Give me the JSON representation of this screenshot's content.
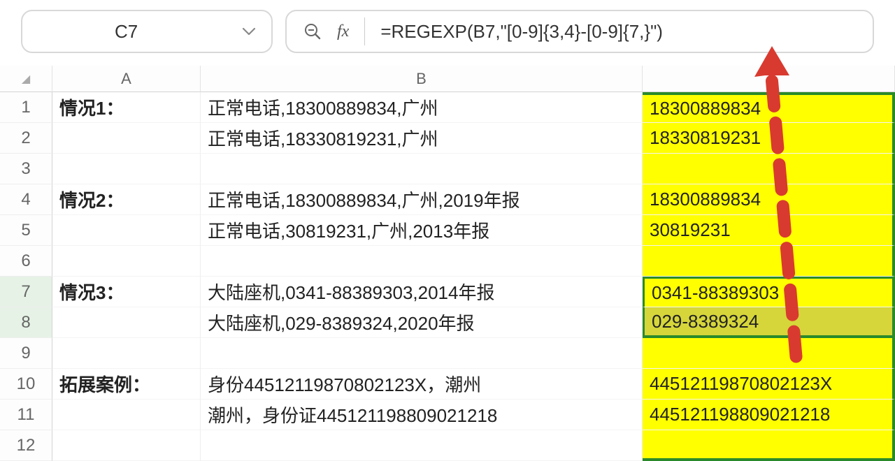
{
  "namebox": {
    "cell_ref": "C7"
  },
  "formula_bar": {
    "fx_label": "fx",
    "formula": "=REGEXP(B7,\"[0-9]{3,4}-[0-9]{7,}\")"
  },
  "columns": [
    "A",
    "B"
  ],
  "rows": [
    {
      "n": "1",
      "A": "情况1：",
      "B": "正常电话,18300889834,广州",
      "C": "18300889834"
    },
    {
      "n": "2",
      "A": "",
      "B": "正常电话,18330819231,广州",
      "C": "18330819231"
    },
    {
      "n": "3",
      "A": "",
      "B": "",
      "C": ""
    },
    {
      "n": "4",
      "A": "情况2：",
      "B": "正常电话,18300889834,广州,2019年报",
      "C": "18300889834"
    },
    {
      "n": "5",
      "A": "",
      "B": "正常电话,30819231,广州,2013年报",
      "C": "30819231"
    },
    {
      "n": "6",
      "A": "",
      "B": "",
      "C": ""
    },
    {
      "n": "7",
      "A": "情况3：",
      "B": "大陆座机,0341-88389303,2014年报",
      "C": "0341-88389303"
    },
    {
      "n": "8",
      "A": "",
      "B": "大陆座机,029-8389324,2020年报",
      "C": "029-8389324"
    },
    {
      "n": "9",
      "A": "",
      "B": "",
      "C": ""
    },
    {
      "n": "10",
      "A": "拓展案例：",
      "B": "身份44512119870802123X，潮州",
      "C": "44512119870802123X"
    },
    {
      "n": "11",
      "A": "",
      "B": "潮州，身份证445121198809021218",
      "C": "445121198809021218"
    },
    {
      "n": "12",
      "A": "",
      "B": "",
      "C": ""
    }
  ]
}
